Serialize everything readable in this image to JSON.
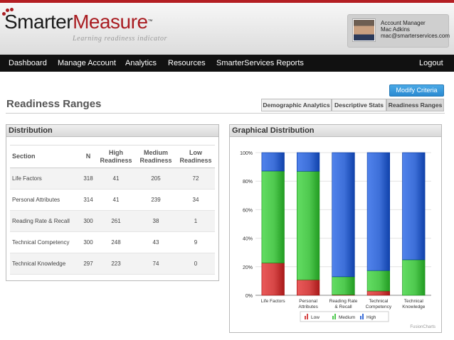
{
  "logo": {
    "brand_part1": "Smarter",
    "brand_part2": "Measure",
    "trademark": "™",
    "tagline": "Learning readiness indicator"
  },
  "account": {
    "role": "Account Manager",
    "name": "Mac Adkins",
    "email": "mac@smarterservices.com"
  },
  "nav": {
    "items": [
      "Dashboard",
      "Manage Account",
      "Analytics",
      "Resources",
      "SmarterServices Reports"
    ],
    "logout": "Logout"
  },
  "page": {
    "title": "Readiness Ranges",
    "modify_button": "Modify Criteria",
    "tabs": [
      "Demographic Analytics",
      "Descriptive Stats",
      "Readiness Ranges"
    ],
    "active_tab": "Readiness Ranges"
  },
  "distribution": {
    "heading": "Distribution",
    "columns": [
      "Section",
      "N",
      "High Readiness",
      "Medium Readiness",
      "Low Readiness"
    ],
    "rows": [
      [
        "Life Factors",
        "318",
        "41",
        "205",
        "72"
      ],
      [
        "Personal Attributes",
        "314",
        "41",
        "239",
        "34"
      ],
      [
        "Reading Rate & Recall",
        "300",
        "261",
        "38",
        "1"
      ],
      [
        "Technical Competency",
        "300",
        "248",
        "43",
        "9"
      ],
      [
        "Technical Knowledge",
        "297",
        "223",
        "74",
        "0"
      ]
    ]
  },
  "graph": {
    "heading": "Graphical Distribution",
    "credit": "FusionCharts"
  },
  "chart_data": {
    "type": "bar",
    "stacked": true,
    "percent": true,
    "categories": [
      "Life Factors",
      "Personal Attributes",
      "Reading Rate & Recall",
      "Technical Competency",
      "Technical Knowledge"
    ],
    "category_lines": [
      [
        "Life Factors"
      ],
      [
        "Personal",
        "Attributes"
      ],
      [
        "Reading Rate",
        "& Recall"
      ],
      [
        "Technical",
        "Competency"
      ],
      [
        "Technical",
        "Knowledge"
      ]
    ],
    "series": [
      {
        "name": "Low",
        "values": [
          72,
          34,
          1,
          9,
          0
        ],
        "color": "#d64646"
      },
      {
        "name": "Medium",
        "values": [
          205,
          239,
          38,
          43,
          74
        ],
        "color": "#4fc94f"
      },
      {
        "name": "High",
        "values": [
          41,
          41,
          261,
          248,
          223
        ],
        "color": "#3d6fd8"
      }
    ],
    "y_ticks": [
      "0%",
      "20%",
      "40%",
      "60%",
      "80%",
      "100%"
    ],
    "ylim": [
      0,
      100
    ],
    "legend_position": "bottom"
  }
}
